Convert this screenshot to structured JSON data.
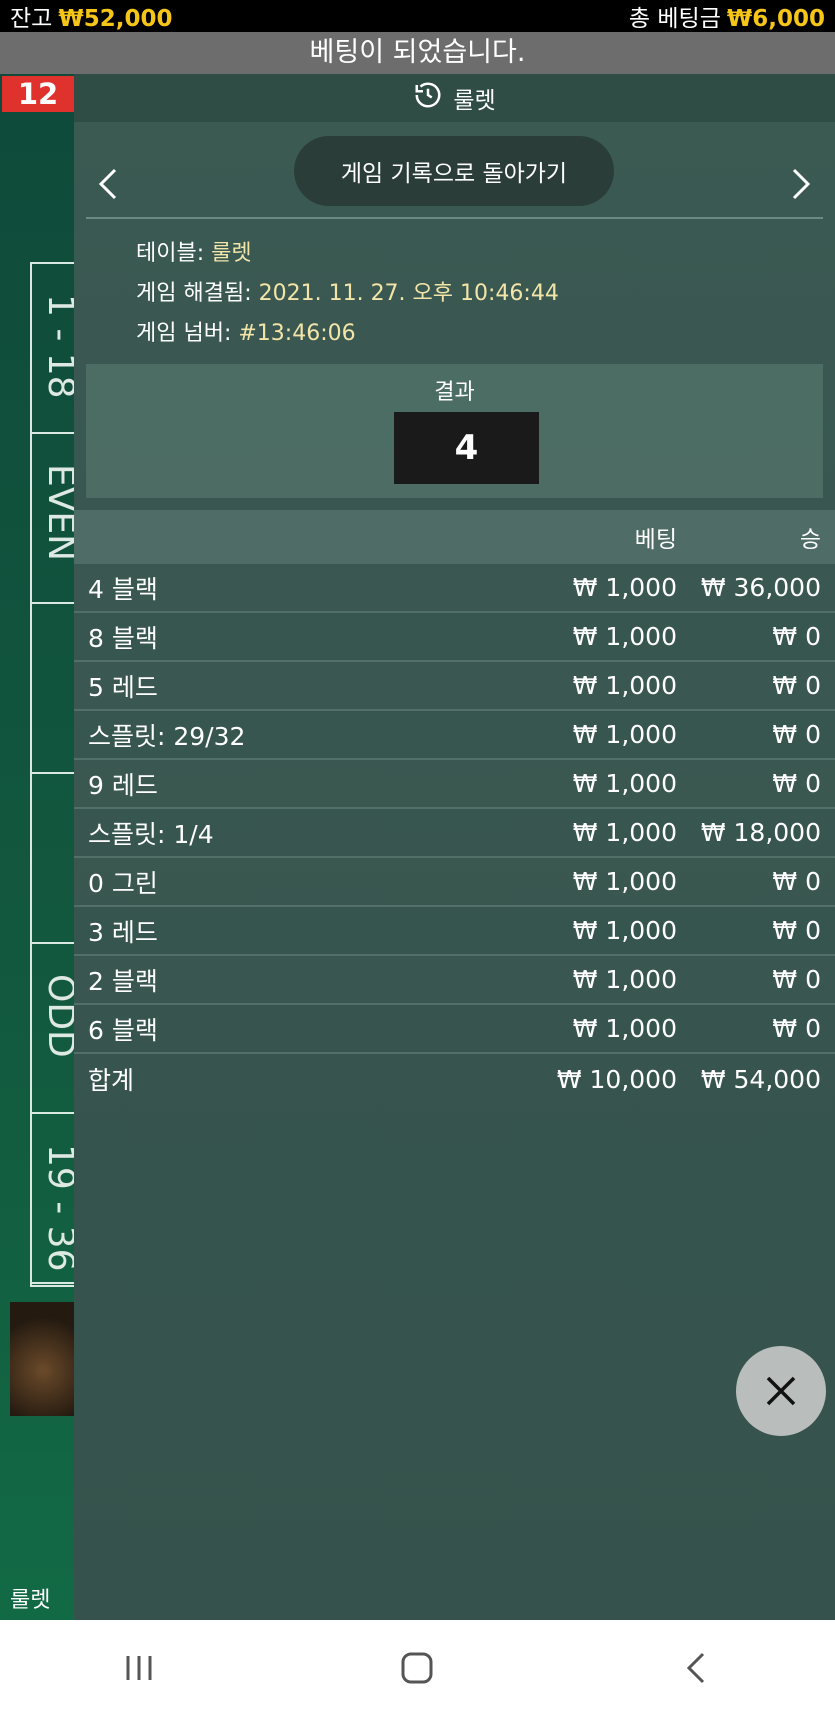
{
  "status": {
    "balance_label": "잔고",
    "balance_value": "₩52,000",
    "total_bet_label": "총 베팅금",
    "total_bet_value": "₩6,000",
    "banner": "베팅이 되었습니다."
  },
  "background": {
    "number_badge": "12",
    "side_labels": [
      "1 - 18",
      "EVEN",
      "",
      "",
      "ODD",
      "19 - 36"
    ],
    "bottom_label": "룰렛",
    "accent_red": "#e0322c",
    "accent_gold": "#f5c518"
  },
  "panel": {
    "title": "룰렛",
    "title_icon": "history-icon",
    "back_button": "게임 기록으로 돌아가기",
    "info": {
      "table_key": "테이블: ",
      "table_value": "룰렛",
      "resolved_key": "게임 해결됨: ",
      "resolved_value": "2021. 11. 27. 오후 10:46:44",
      "number_key": "게임 넘버: ",
      "number_value": "#13:46:06"
    },
    "result_label": "결과",
    "result_value": "4",
    "columns": {
      "bet": "베팅",
      "win": "승"
    },
    "rows": [
      {
        "name": "4 블랙",
        "bet": "₩ 1,000",
        "win": "₩ 36,000"
      },
      {
        "name": "8 블랙",
        "bet": "₩ 1,000",
        "win": "₩ 0"
      },
      {
        "name": "5 레드",
        "bet": "₩ 1,000",
        "win": "₩ 0"
      },
      {
        "name": "스플릿: 29/32",
        "bet": "₩ 1,000",
        "win": "₩ 0"
      },
      {
        "name": "9 레드",
        "bet": "₩ 1,000",
        "win": "₩ 0"
      },
      {
        "name": "스플릿: 1/4",
        "bet": "₩ 1,000",
        "win": "₩ 18,000"
      },
      {
        "name": "0 그린",
        "bet": "₩ 1,000",
        "win": "₩ 0"
      },
      {
        "name": "3 레드",
        "bet": "₩ 1,000",
        "win": "₩ 0"
      },
      {
        "name": "2 블랙",
        "bet": "₩ 1,000",
        "win": "₩ 0"
      },
      {
        "name": "6 블랙",
        "bet": "₩ 1,000",
        "win": "₩ 0"
      }
    ],
    "total": {
      "label": "합계",
      "bet": "₩ 10,000",
      "win": "₩ 54,000"
    }
  }
}
